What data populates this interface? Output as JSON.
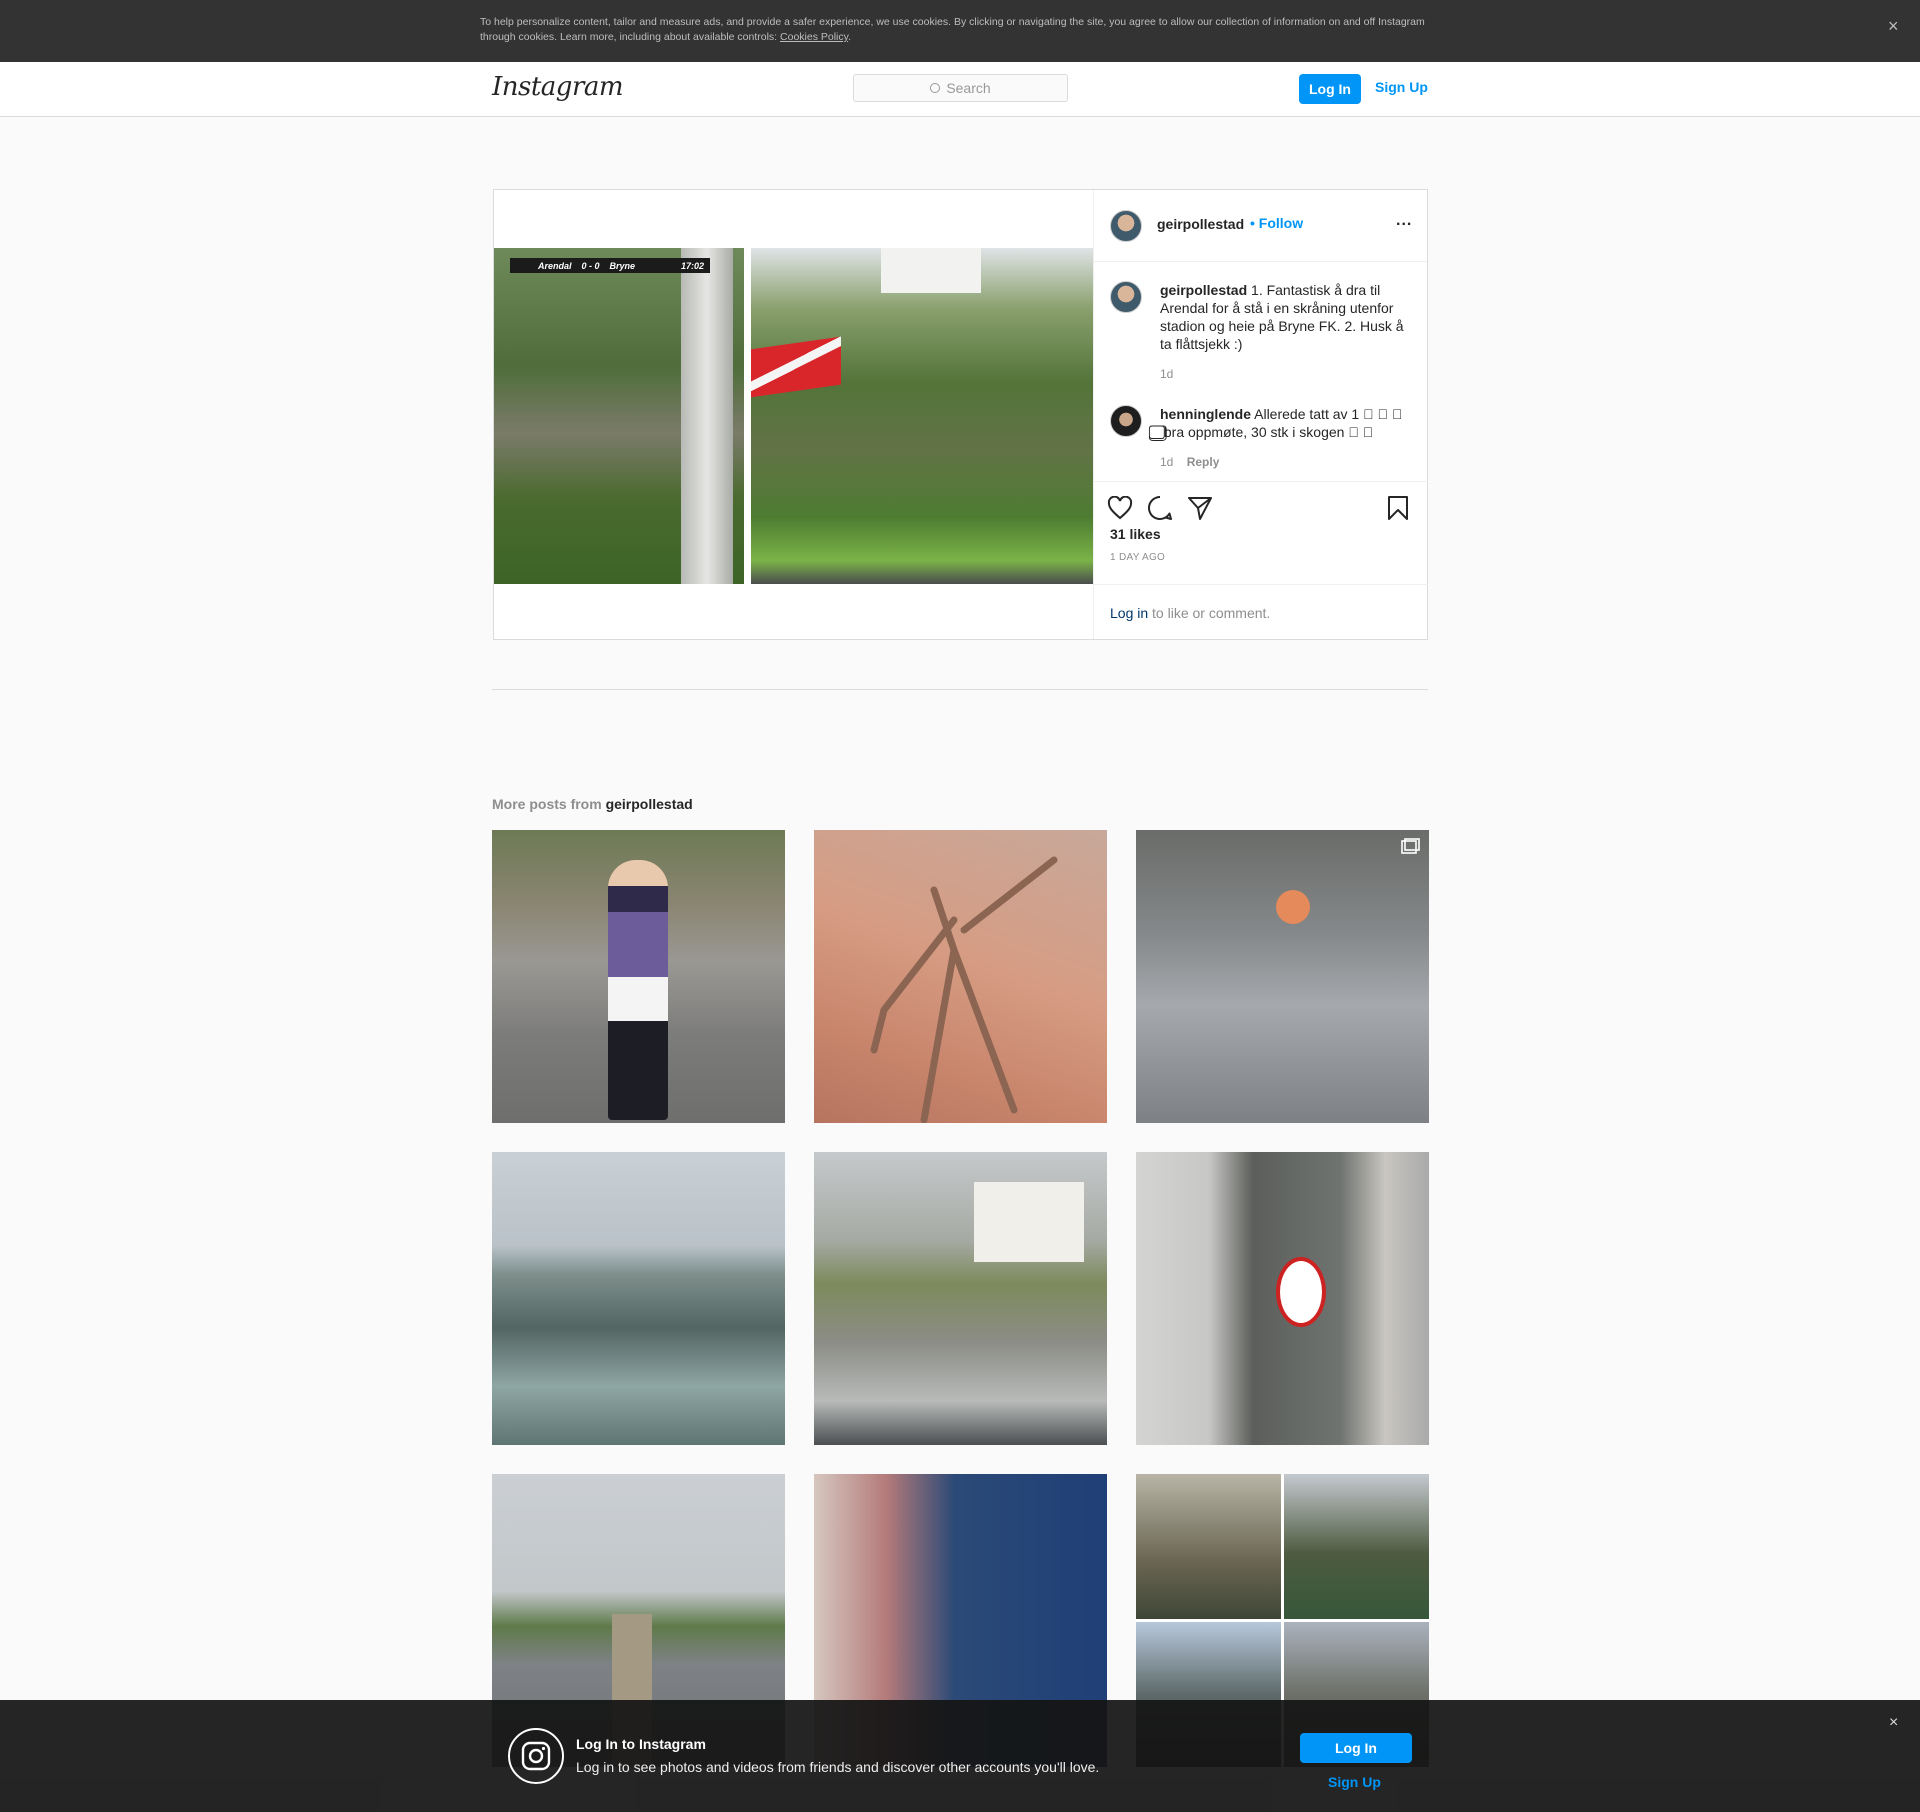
{
  "cookie": {
    "text": "To help personalize content, tailor and measure ads, and provide a safer experience, we use cookies. By clicking or navigating the site, you agree to allow our collection of information on and off Instagram through cookies. Learn more, including about available controls: ",
    "link": "Cookies Policy",
    "after_link": ".",
    "close": "×"
  },
  "header": {
    "logo": "Instagram",
    "search_placeholder": "Search",
    "login": "Log In",
    "signup": "Sign Up"
  },
  "post": {
    "scoreboard": {
      "home": "Arendal",
      "score": "0 - 0",
      "away": "Bryne",
      "time": "17:02"
    },
    "owner": "geirpollestad",
    "follow": "• Follow",
    "more": "...",
    "comments": [
      {
        "user": "geirpollestad",
        "text": "1. Fantastisk å dra til Arendal for å stå i en skråning utenfor stadion og heie på Bryne FK. 2. Husk å ta flåttsjekk :)",
        "time": "1d",
        "reply": ""
      },
      {
        "user": "henninglende",
        "text": "Allerede tatt av 1 ⃣ ⃣ ⃣ ⃣ bra oppmøte, 30 stk i skogen ⃣ ⃣",
        "time": "1d",
        "reply": "Reply"
      }
    ],
    "likes": "31 likes",
    "ago": "1 DAY AGO",
    "login_link": "Log in",
    "login_rest": " to like or comment."
  },
  "more_posts": {
    "prefix": "More posts from ",
    "user": "geirpollestad"
  },
  "icons": [
    "heart-icon",
    "comment-icon",
    "share-icon",
    "bookmark-icon",
    "search-icon",
    "camera-icon",
    "close-icon"
  ],
  "colors": {
    "accent": "#0095f6",
    "text": "#262626",
    "muted": "#8e8e8e",
    "border": "#dbdbdb"
  },
  "loginbar": {
    "title": "Log In to Instagram",
    "subtitle": "Log in to see photos and videos from friends and discover other accounts you'll love.",
    "login": "Log In",
    "signup": "Sign Up",
    "close": "×"
  }
}
